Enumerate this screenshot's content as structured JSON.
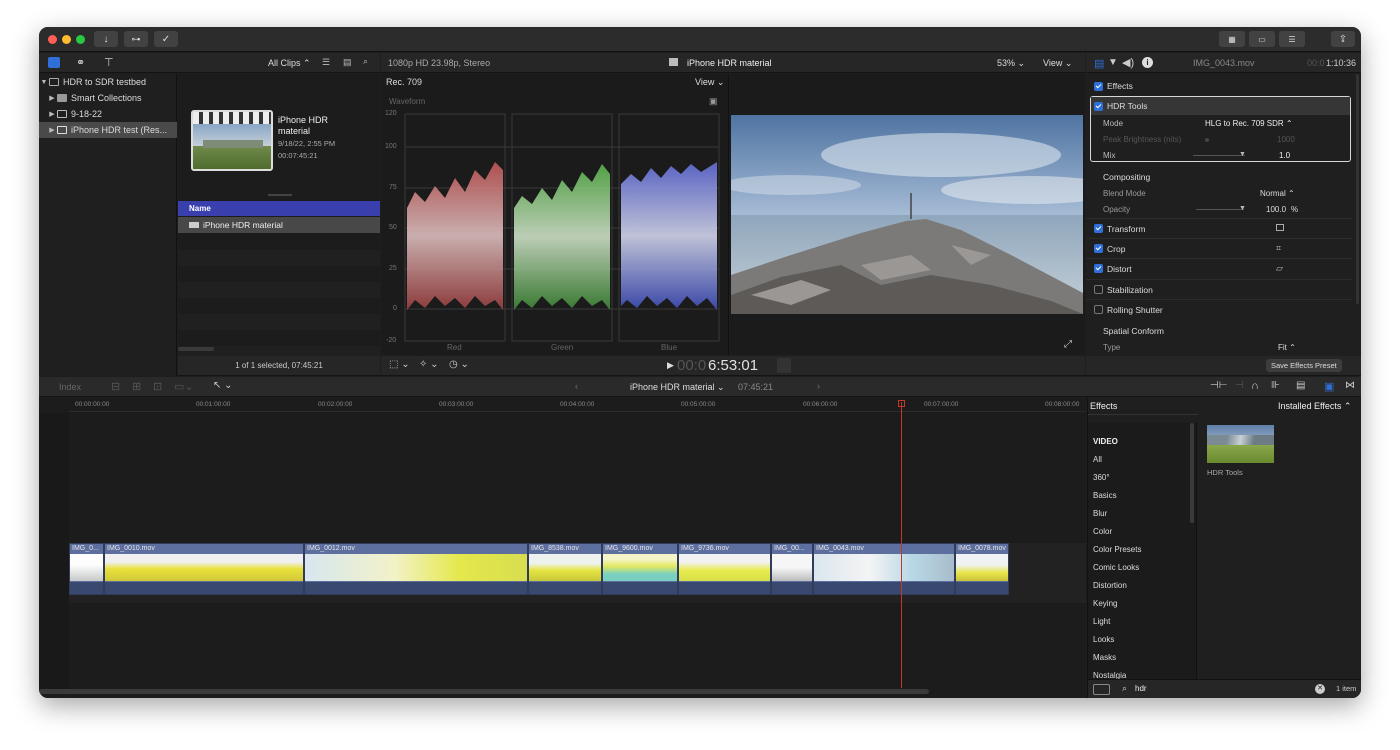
{
  "colors": {
    "accent": "#2f6fd8",
    "selection": "#4a4ab0",
    "playhead": "#c0392b",
    "clip": "#5c6f9f"
  },
  "titlebar": {
    "traffic_lights": [
      "#ff5f57",
      "#febc2e",
      "#28c840"
    ],
    "tool_icons": [
      "download-icon",
      "key-icon",
      "check-circle-icon"
    ],
    "right_icons": [
      "browser-layout-icon",
      "timeline-layout-icon",
      "inspector-layout-icon",
      "share-icon"
    ]
  },
  "browser": {
    "filter_label": "All Clips ⌃",
    "library": [
      {
        "label": "HDR to SDR testbed",
        "level": 0,
        "expanded": true
      },
      {
        "label": "Smart Collections",
        "level": 1
      },
      {
        "label": "9-18-22",
        "level": 1
      },
      {
        "label": "iPhone HDR test (Res...",
        "level": 1,
        "selected": true
      }
    ],
    "project": {
      "title": "iPhone HDR material",
      "date": "9/18/22, 2:55 PM",
      "duration": "00:07:45:21"
    },
    "list_header": "Name",
    "list_item": "iPhone HDR material",
    "status": "1 of 1 selected, 07:45:21"
  },
  "viewer": {
    "format": "1080p HD 23.98p, Stereo",
    "title": "iPhone HDR material",
    "zoom": "53%",
    "view_label": "View",
    "timecode_dim": "00:0",
    "timecode": "6:53:01"
  },
  "scope": {
    "colorspace": "Rec. 709",
    "view_label": "View",
    "name": "Waveform",
    "scale": [
      "120",
      "100",
      "75",
      "50",
      "25",
      "0",
      "-20"
    ],
    "channels": [
      "Red",
      "Green",
      "Blue"
    ]
  },
  "inspector": {
    "clip_name": "IMG_0043.mov",
    "duration_dim": "00:0",
    "duration": "1:10:36",
    "effects_label": "Effects",
    "hdr_tools": {
      "label": "HDR Tools",
      "mode_label": "Mode",
      "mode_value": "HLG to Rec. 709 SDR ⌃",
      "peak_label": "Peak Brightness (nits)",
      "peak_value": "1000",
      "mix_label": "Mix",
      "mix_value": "1.0"
    },
    "compositing": {
      "label": "Compositing",
      "blend_label": "Blend Mode",
      "blend_value": "Normal ⌃",
      "opacity_label": "Opacity",
      "opacity_value": "100.0",
      "opacity_unit": "%"
    },
    "sections": [
      {
        "label": "Transform",
        "checked": true
      },
      {
        "label": "Crop",
        "checked": true
      },
      {
        "label": "Distort",
        "checked": true
      },
      {
        "label": "Stabilization",
        "checked": false
      },
      {
        "label": "Rolling Shutter",
        "checked": false
      }
    ],
    "spatial": {
      "label": "Spatial Conform",
      "type_label": "Type",
      "type_value": "Fit ⌃"
    },
    "save_preset": "Save Effects Preset"
  },
  "timeline": {
    "index_label": "Index",
    "project_name": "iPhone HDR material",
    "project_duration": "07:45:21",
    "ruler": [
      "00:00:00:00",
      "00:01:00:00",
      "00:02:00:00",
      "00:03:00:00",
      "00:04:00:00",
      "00:05:00:00",
      "00:06:00:00",
      "00:07:00:00",
      "00:08:00:00"
    ],
    "clips": [
      "IMG_0...",
      "IMG_0010.mov",
      "IMG_0012.mov",
      "IMG_8538.mov",
      "IMG_9600.mov",
      "IMG_9736.mov",
      "IMG_00...",
      "IMG_0043.mov",
      "IMG_0078.mov"
    ]
  },
  "effects_browser": {
    "title": "Effects",
    "installed": "Installed Effects ⌃",
    "section": "VIDEO",
    "categories": [
      "All",
      "360°",
      "Basics",
      "Blur",
      "Color",
      "Color Presets",
      "Comic Looks",
      "Distortion",
      "Keying",
      "Light",
      "Looks",
      "Masks",
      "Nostalgia"
    ],
    "result_name": "HDR Tools",
    "search_value": "hdr",
    "count": "1 item"
  }
}
